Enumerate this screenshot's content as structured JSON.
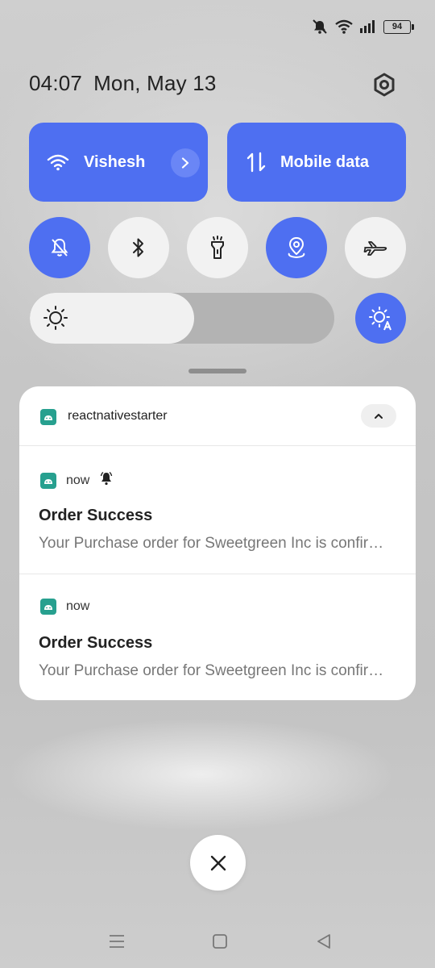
{
  "status_bar": {
    "icons": [
      "mute-icon",
      "wifi-icon",
      "signal-icon"
    ],
    "battery": "94"
  },
  "header": {
    "time": "04:07",
    "date": "Mon, May 13"
  },
  "tiles": {
    "wifi": {
      "label": "Vishesh",
      "active": true
    },
    "mobile": {
      "label": "Mobile data",
      "active": true
    }
  },
  "toggles": [
    {
      "name": "silent-toggle",
      "icon": "bell-off-icon",
      "active": true
    },
    {
      "name": "bluetooth-toggle",
      "icon": "bluetooth-icon",
      "active": false
    },
    {
      "name": "flashlight-toggle",
      "icon": "flashlight-icon",
      "active": false
    },
    {
      "name": "location-toggle",
      "icon": "location-icon",
      "active": true
    },
    {
      "name": "airplane-toggle",
      "icon": "airplane-icon",
      "active": false
    }
  ],
  "brightness": {
    "level": 0.54,
    "auto": true
  },
  "notification_group": {
    "app_name": "reactnativestarter",
    "items": [
      {
        "time": "now",
        "title": "Order Success",
        "body": "Your Purchase order for Sweetgreen Inc is confirmed",
        "has_alert_icon": true
      },
      {
        "time": "now",
        "title": "Order Success",
        "body": "Your Purchase order for Sweetgreen Inc is confirmed",
        "has_alert_icon": false
      }
    ]
  },
  "colors": {
    "accent": "#4e6ff1",
    "app_icon": "#27a08f"
  }
}
